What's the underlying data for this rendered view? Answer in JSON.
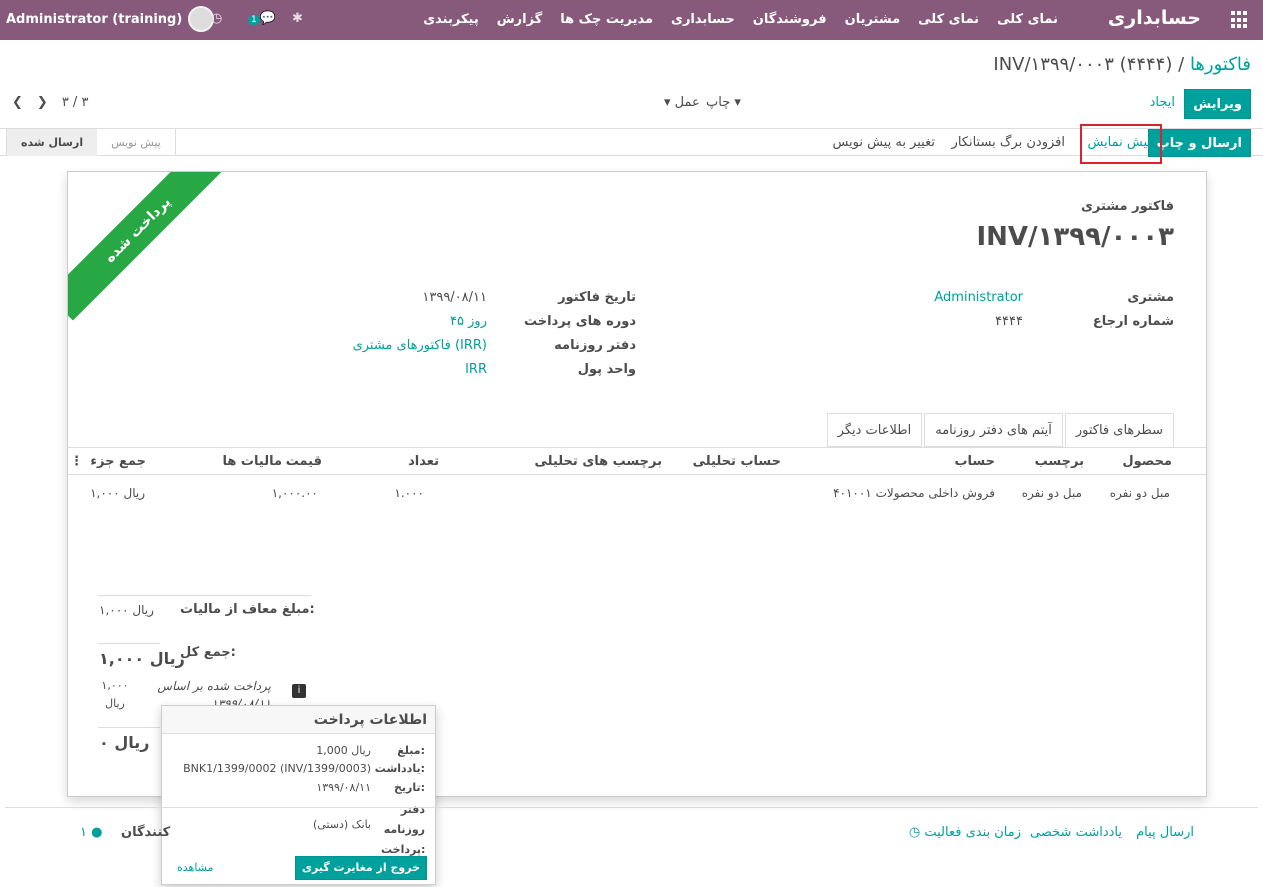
{
  "topbar": {
    "brand": "حسابداری",
    "menu": [
      "نمای کلی",
      "نمای کلی",
      "مشتریان",
      "فروشندگان",
      "حسابداری",
      "مدیریت چک ها",
      "گزارش",
      "پیکربندی"
    ],
    "user": "Administrator (training)",
    "chat_count": "1"
  },
  "breadcrumb": {
    "parent": "فاکتورها",
    "sep": "/",
    "current": "INV/۱۳۹۹/۰۰۰۳ (۴۴۴۴)"
  },
  "controls": {
    "edit": "ویرایش",
    "create": "ایجاد",
    "print": "چاپ",
    "action": "عمل",
    "pager": "۳ / ۳"
  },
  "actions": {
    "send_print": "ارسال و چاپ",
    "preview": "پیش نمایش",
    "credit_note": "افزودن برگ بستانکار",
    "reset_draft": "تغییر به پیش نویس"
  },
  "stages": {
    "sent": "ارسال شده",
    "draft": "پیش نویس"
  },
  "invoice": {
    "ribbon": "پرداخت شده",
    "type": "فاکتور مشتری",
    "number": "INV/۱۳۹۹/۰۰۰۳",
    "customer_label": "مشتری",
    "customer": "Administrator",
    "ref_label": "شماره ارجاع",
    "ref": "۴۴۴۴",
    "date_label": "تاریخ فاکتور",
    "date": "۱۳۹۹/۰۸/۱۱",
    "terms_label": "دوره های پرداخت",
    "terms": "۴۵ روز",
    "journal_label": "دفتر روزنامه",
    "journal": "فاکتورهای مشتری (IRR)",
    "currency_label": "واحد پول",
    "currency": "IRR"
  },
  "tabs": [
    "سطرهای فاکتور",
    "آیتم های دفتر روزنامه",
    "اطلاعات دیگر"
  ],
  "table": {
    "headers": [
      "محصول",
      "برچسب",
      "حساب",
      "حساب تحلیلی",
      "برچسب های تحلیلی",
      "تعداد",
      "قیمت",
      "مالیات ها",
      "جمع جزء"
    ],
    "rows": [
      [
        "مبل دو نفره",
        "مبل دو نفره",
        "۴۰۱۰۰۱ فروش داخلی محصولات",
        "",
        "",
        "۱.۰۰۰",
        "۱,۰۰۰.۰۰",
        "",
        "۱,۰۰۰ ریال"
      ]
    ]
  },
  "totals": {
    "untaxed_label": "مبلغ معاف از مالیات:",
    "untaxed": "۱,۰۰۰ ریال",
    "total_label": "جمع کل:",
    "total": "۱,۰۰۰ ریال",
    "paid_note": "پرداخت شده بر اساس ۱۳۹۹/۰۸/۱۱",
    "paid_amount": "۱,۰۰۰ ریال",
    "due": "۰ ریال"
  },
  "popover": {
    "title": "اطلاعات پرداخت",
    "amount_label": "مبلغ:",
    "amount": "1,000 ریال",
    "memo_label": "یادداشت:",
    "memo": "BNK1/1399/0002 (INV/1399/0003)",
    "date_label": "تاریخ:",
    "date": "۱۳۹۹/۰۸/۱۱",
    "journal_label": "دفتر روزنامه پرداخت:",
    "journal": "بانک (دستی)",
    "unreconcile": "خروج از مغایرت گیری",
    "view": "مشاهده"
  },
  "chatter": {
    "send": "ارسال پیام",
    "note": "یادداشت شخصی",
    "schedule": "زمان بندی فعالیت",
    "followers": "کنندگان",
    "follower_count": "۱"
  }
}
